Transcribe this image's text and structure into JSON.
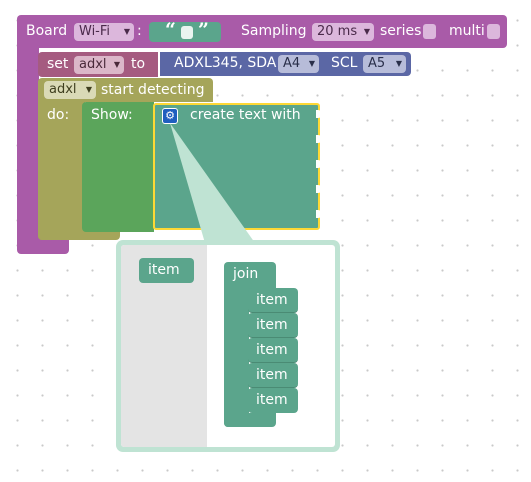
{
  "board": {
    "label": "Board",
    "mode": "Wi-Fi",
    "colon": ":",
    "quote_open": "“",
    "quote_close": "”",
    "sampling_label": "Sampling",
    "sampling_value": "20 ms",
    "series_label": "series",
    "multi_label": "multi"
  },
  "set_block": {
    "label": "set",
    "variable": "adxl",
    "to_label": "to",
    "sensor_label": "ADXL345, SDA",
    "sda_pin": "A4",
    "scl_label": "SCL",
    "scl_pin": "A5"
  },
  "detect_block": {
    "variable": "adxl",
    "label": "start detecting",
    "do_label": "do:"
  },
  "show_block": {
    "label": "Show:"
  },
  "text_block": {
    "label": "create text with"
  },
  "mutator": {
    "item_label": "item",
    "join_label": "join",
    "items": [
      "item",
      "item",
      "item",
      "item",
      "item"
    ]
  },
  "colors": {
    "board": "#a95ba8",
    "sensor": "#5b67a5",
    "detect": "#a5a55a",
    "show": "#5ba55b",
    "text": "#5ba58c",
    "highlight": "#fdd835",
    "bubble": "#bfe3d3",
    "flyout": "#e4e4e4"
  },
  "icons": {
    "arrow": "dropdown-arrow-icon",
    "mutator": "gear-icon",
    "checkbox": "checkbox-icon"
  }
}
